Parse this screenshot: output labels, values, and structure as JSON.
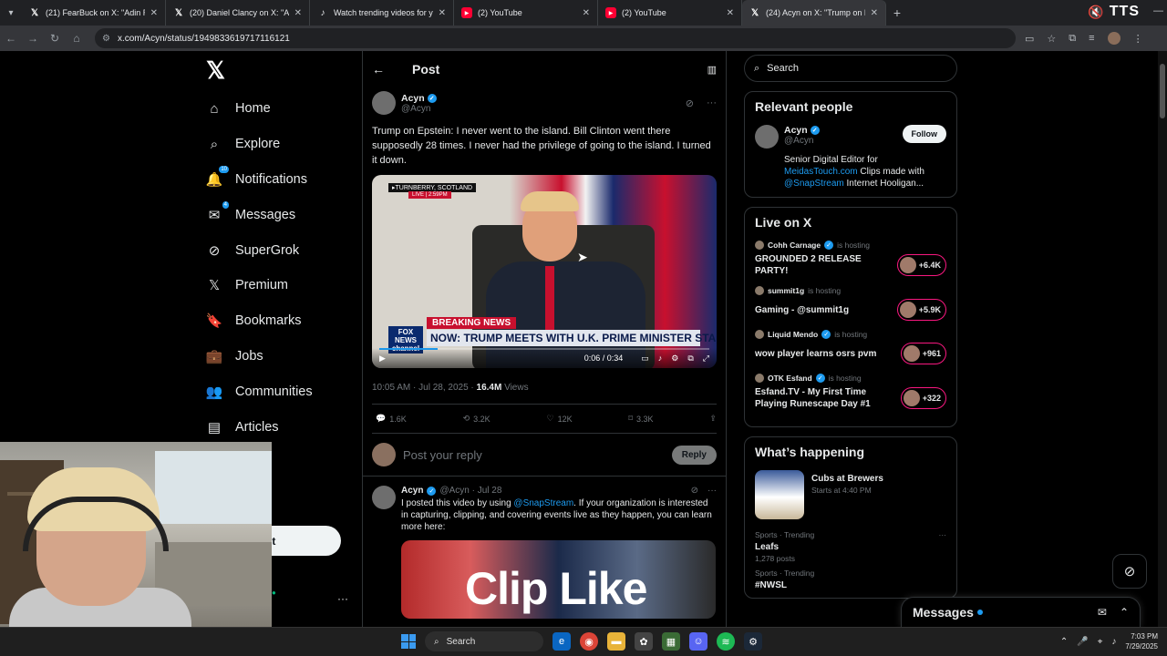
{
  "browser": {
    "tabs": [
      {
        "icon": "x-icon",
        "title": "(21) FearBuck on X: \"Adin Ross",
        "active": false
      },
      {
        "icon": "x-icon",
        "title": "(20) Daniel Clancy on X: \"As hig",
        "active": false
      },
      {
        "icon": "tiktok-icon",
        "title": "Watch trending videos for you",
        "active": false
      },
      {
        "icon": "youtube-icon",
        "title": "(2) YouTube",
        "active": false
      },
      {
        "icon": "youtube-icon",
        "title": "(2) YouTube",
        "active": false
      },
      {
        "icon": "x-icon",
        "title": "(24) Acyn on X: \"Trump on Eps",
        "active": true
      }
    ],
    "tts_brand": "TTS",
    "url": "x.com/Acyn/status/1949833619717116121"
  },
  "sidebar": {
    "logo": "𝕏",
    "items": [
      {
        "icon": "home-icon",
        "glyph": "⌂",
        "label": "Home"
      },
      {
        "icon": "search-icon",
        "glyph": "⌕",
        "label": "Explore"
      },
      {
        "icon": "bell-icon",
        "glyph": "🔔",
        "label": "Notifications",
        "badge": "10"
      },
      {
        "icon": "mail-icon",
        "glyph": "✉",
        "label": "Messages",
        "badge": "4"
      },
      {
        "icon": "grok-icon",
        "glyph": "⊘",
        "label": "SuperGrok"
      },
      {
        "icon": "x-premium-icon",
        "glyph": "𝕏",
        "label": "Premium"
      },
      {
        "icon": "bookmark-icon",
        "glyph": "🔖",
        "label": "Bookmarks"
      },
      {
        "icon": "briefcase-icon",
        "glyph": "💼",
        "label": "Jobs"
      },
      {
        "icon": "communities-icon",
        "glyph": "👥",
        "label": "Communities"
      },
      {
        "icon": "articles-icon",
        "glyph": "▤",
        "label": "Articles"
      }
    ],
    "post_button": "st",
    "more": "···"
  },
  "main": {
    "header_title": "Post",
    "tweet": {
      "name": "Acyn",
      "handle": "@Acyn",
      "text": "Trump on Epstein: I never went to the island. Bill Clinton went there supposedly 28 times. I never had the privilege of going to the island. I turned it down.",
      "video": {
        "location": "▸TURNBERRY, SCOTLAND",
        "live": "LIVE | 2:59PM",
        "breaking": "BREAKING NEWS",
        "headline": "NOW: TRUMP MEETS WITH U.K. PRIME MINISTER STARMER",
        "network": "FOX NEWS channel",
        "time": "0:06 / 0:34",
        "progress": 0.176
      },
      "timestamp": "10:05 AM · Jul 28, 2025 · ",
      "views_count": "16.4M",
      "views_label": " Views",
      "actions": {
        "replies": "1.6K",
        "reposts": "3.2K",
        "likes": "12K",
        "bookmarks": "3.3K"
      }
    },
    "reply_placeholder": "Post your reply",
    "reply_button": "Reply",
    "reply": {
      "name": "Acyn",
      "handle": "@Acyn · Jul 28",
      "text_before": "I posted this video by using ",
      "link": "@SnapStream",
      "text_after": ". If your organization is interested in capturing, clipping, and covering events live as they happen, you can learn more here:",
      "image_text": "Clip Like"
    }
  },
  "right": {
    "search_placeholder": "Search",
    "relevant": {
      "title": "Relevant people",
      "name": "Acyn",
      "handle": "@Acyn",
      "follow": "Follow",
      "bio_1": "Senior Digital Editor for ",
      "bio_link1": "MeidasTouch.com",
      "bio_2": " Clips made with ",
      "bio_link2": "@SnapStream",
      "bio_3": " Internet Hooligan..."
    },
    "live": {
      "title": "Live on X",
      "items": [
        {
          "host": "Cohh Carnage",
          "status": "is hosting",
          "title": "GROUNDED 2 RELEASE PARTY!",
          "count": "+6.4K"
        },
        {
          "host": "summit1g",
          "status": "is hosting",
          "title": "Gaming - @summit1g",
          "count": "+5.9K"
        },
        {
          "host": "Liquid Mendo",
          "status": "is hosting",
          "title": "wow player learns osrs pvm",
          "count": "+961"
        },
        {
          "host": "OTK Esfand",
          "status": "is hosting",
          "title": "Esfand.TV - My First Time Playing Runescape Day #1",
          "count": "+322"
        }
      ]
    },
    "happening": {
      "title": "What’s happening",
      "event_title": "Cubs at Brewers",
      "event_time": "Starts at 4:40 PM",
      "trends": [
        {
          "context": "Sports · Trending",
          "name": "Leafs",
          "count": "1,278 posts"
        },
        {
          "context": "Sports · Trending",
          "name": "#NWSL",
          "count": ""
        }
      ]
    }
  },
  "messages_dock": {
    "title": "Messages"
  },
  "taskbar": {
    "search": "Search",
    "time": "7:03 PM",
    "date": "7/29/2025"
  }
}
